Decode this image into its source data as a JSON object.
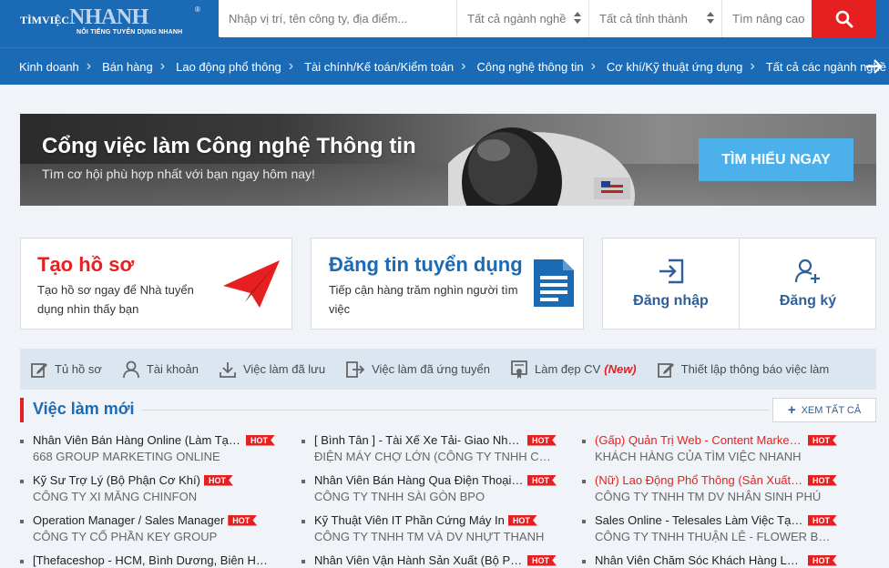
{
  "header": {
    "logo_small": "TÌMVIỆC",
    "logo_big": "NHANH",
    "logo_tagline": "NỔI TIẾNG TUYỂN DỤNG NHANH",
    "logo_reg": "®",
    "search": {
      "keyword_placeholder": "Nhập vị trí, tên công ty, địa điểm...",
      "industry_value": "Tất cả ngành nghề",
      "location_value": "Tất cả tỉnh thành",
      "advanced_label": "Tìm nâng cao"
    }
  },
  "category_nav": {
    "items": [
      {
        "label": "Kinh doanh"
      },
      {
        "label": "Bán hàng"
      },
      {
        "label": "Lao động phổ thông"
      },
      {
        "label": "Tài chính/Kế toán/Kiểm toán"
      },
      {
        "label": "Công nghệ thông tin"
      },
      {
        "label": "Cơ khí/Kỹ thuật ứng dụng"
      },
      {
        "label": "Tất cả các ngành nghề"
      }
    ],
    "separator": "›"
  },
  "banner": {
    "title": "Cổng việc làm Công nghệ Thông tin",
    "subtitle": "Tìm cơ hội phù hợp nhất với bạn ngay hôm nay!",
    "button_label": "TÌM HIỂU NGAY"
  },
  "cards": {
    "profile": {
      "title": "Tạo hồ sơ",
      "description": "Tạo hồ sơ ngay để Nhà tuyển dụng nhìn thấy bạn"
    },
    "post_job": {
      "title": "Đăng tin tuyển dụng",
      "description": "Tiếp cận hàng trăm nghìn người tìm việc"
    },
    "auth": {
      "login_label": "Đăng nhập",
      "register_label": "Đăng ký"
    }
  },
  "toolbar": {
    "items": [
      {
        "label": "Tủ hồ sơ",
        "icon": "edit-icon"
      },
      {
        "label": "Tài khoản",
        "icon": "user-icon"
      },
      {
        "label": "Việc làm đã lưu",
        "icon": "download-icon"
      },
      {
        "label": "Việc làm đã ứng tuyển",
        "icon": "apply-icon"
      },
      {
        "label": "Làm đẹp CV",
        "icon": "certificate-icon",
        "badge": "(New)"
      },
      {
        "label": "Thiết lập thông báo việc làm",
        "icon": "edit-icon"
      }
    ]
  },
  "jobs_section": {
    "title": "Việc làm mới",
    "see_all_label": "XEM TẤT CẢ",
    "hot_label": "HOT",
    "jobs": [
      {
        "title": "Nhân Viên Bán Hàng Online (Làm Tại Nhà)",
        "company": "668 GROUP MARKETING ONLINE",
        "urgent": false
      },
      {
        "title": "[ Bình Tân ] - Tài Xế Xe Tải- Giao Nhận Hàng",
        "company": "ĐIỆN MÁY CHỢ LỚN (CÔNG TY TNHH CAO PHONG)",
        "urgent": false
      },
      {
        "title": "(Gấp) Quản Trị Web - Content Marketing",
        "company": "KHÁCH HÀNG CỦA TÌM VIỆC NHANH",
        "urgent": true
      },
      {
        "title": "Kỹ Sư Trợ Lý (Bộ Phận Cơ Khí)",
        "company": "CÔNG TY XI MĂNG CHINFON",
        "urgent": false
      },
      {
        "title": "Nhân Viên Bán Hàng Qua Điện Thoại (Telesales)",
        "company": "CÔNG TY TNHH SÀI GÒN BPO",
        "urgent": false
      },
      {
        "title": "(Nữ) Lao Động Phổ Thông (Sản Xuất Bao Bì)",
        "company": "CÔNG TY TNHH TM DV NHÂN SINH PHÚ",
        "urgent": true
      },
      {
        "title": "Operation Manager / Sales Manager",
        "company": "CÔNG TY CỔ PHẦN KEY GROUP",
        "urgent": false
      },
      {
        "title": "Kỹ Thuật Viên IT Phần Cứng Máy In",
        "company": "CÔNG TY TNHH TM VÀ DV NHỰT THANH",
        "urgent": false
      },
      {
        "title": "Sales Online - Telesales Làm Việc Tại Nhà",
        "company": "CÔNG TY TNHH THUẬN LÊ - FLOWER BOX",
        "urgent": false
      },
      {
        "title": "[Thefaceshop - HCM, Bình Dương, Biên Hòa] Nhân Viên",
        "company": "",
        "urgent": false
      },
      {
        "title": "Nhân Viên Vận Hành Sản Xuất (Bộ Phận Kho)",
        "company": "",
        "urgent": false
      },
      {
        "title": "Nhân Viên Chăm Sóc Khách Hàng Làm Việc",
        "company": "",
        "urgent": false
      }
    ]
  },
  "colors": {
    "primary": "#1b6ab5",
    "accent_red": "#e62020",
    "button_blue": "#4cb1ea",
    "toolbar_bg": "#dbe6f1"
  }
}
